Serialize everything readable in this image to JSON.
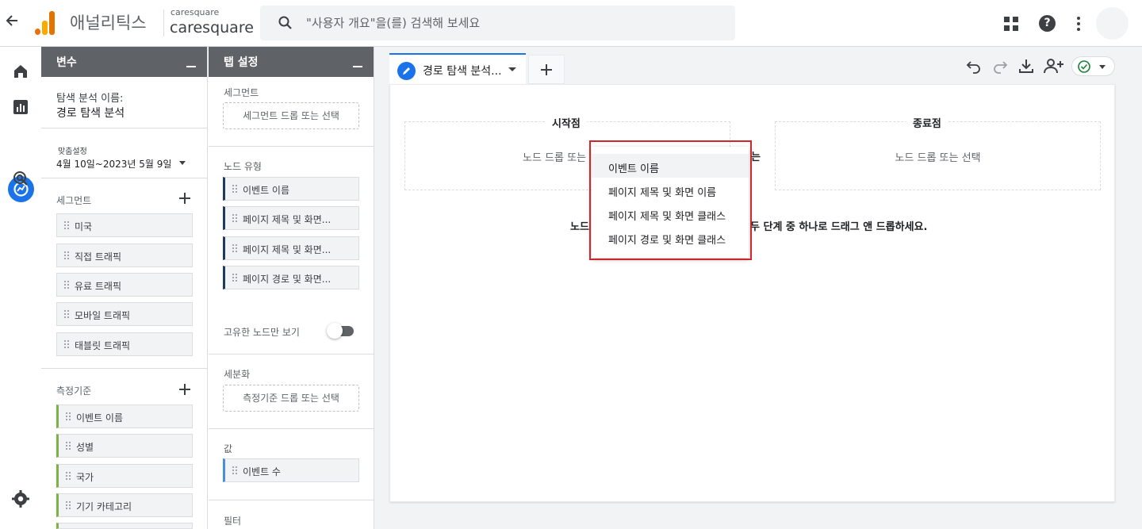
{
  "app": {
    "name": "애널리틱스",
    "account_small": "caresquare",
    "account_big": "caresquare",
    "search_placeholder": "\"사용자 개요\"을(를) 검색해 보세요"
  },
  "variables_panel": {
    "title": "변수",
    "exploration_name_label": "탐색 분석 이름:",
    "exploration_name": "경로 탐색 분석",
    "date_custom_label": "맞춤설정",
    "date_range": "4월 10일~2023년 5월 9일",
    "segments_label": "세그먼트",
    "segments": [
      "미국",
      "직접 트래픽",
      "유료 트래픽",
      "모바일 트래픽",
      "태블릿 트래픽"
    ],
    "metrics_label": "측정기준",
    "metrics": [
      "이벤트 이름",
      "성별",
      "국가",
      "기기 카테고리"
    ]
  },
  "tab_settings_panel": {
    "title": "탭 설정",
    "segment_label": "세그먼트",
    "segment_drop": "세그먼트 드롭 또는 선택",
    "node_type_label": "노드 유형",
    "node_types": [
      "이벤트 이름",
      "페이지 제목 및 화면...",
      "페이지 제목 및 화면...",
      "페이지 경로 및 화면..."
    ],
    "unique_nodes_label": "고유한 노드만 보기",
    "unique_nodes_on": false,
    "breakdown_label": "세분화",
    "breakdown_drop": "측정기준 드롭 또는 선택",
    "values_label": "값",
    "value_item": "이벤트 수",
    "filters_label": "필터"
  },
  "canvas": {
    "tab_label": "경로 탐색 분석...",
    "start_title": "시작점",
    "start_hint": "노드 드롭 또는 선택",
    "start_hint_visible": "노드 드롭 또는",
    "or_tail": "는",
    "end_title": "종료점",
    "end_hint": "노드 드롭 또는 선택",
    "instruction_prefix": "노드",
    "instruction_suffix": "두 단계 중 하나로 드래그 앤 드롭하세요.",
    "status_color": "#188038"
  },
  "dropdown_menu": {
    "items": [
      "이벤트 이름",
      "페이지 제목 및 화면 이름",
      "페이지 제목 및 화면 클래스",
      "페이지 경로 및 화면 클래스"
    ],
    "highlighted_index": 0,
    "annotation_color": "#d0252b"
  },
  "colors": {
    "accent": "#1a73e8",
    "panel_header": "#5f6368",
    "dimension_bar": "#1e3a5f",
    "metric_bar": "#7cb342",
    "value_bar": "#4a90d9"
  }
}
